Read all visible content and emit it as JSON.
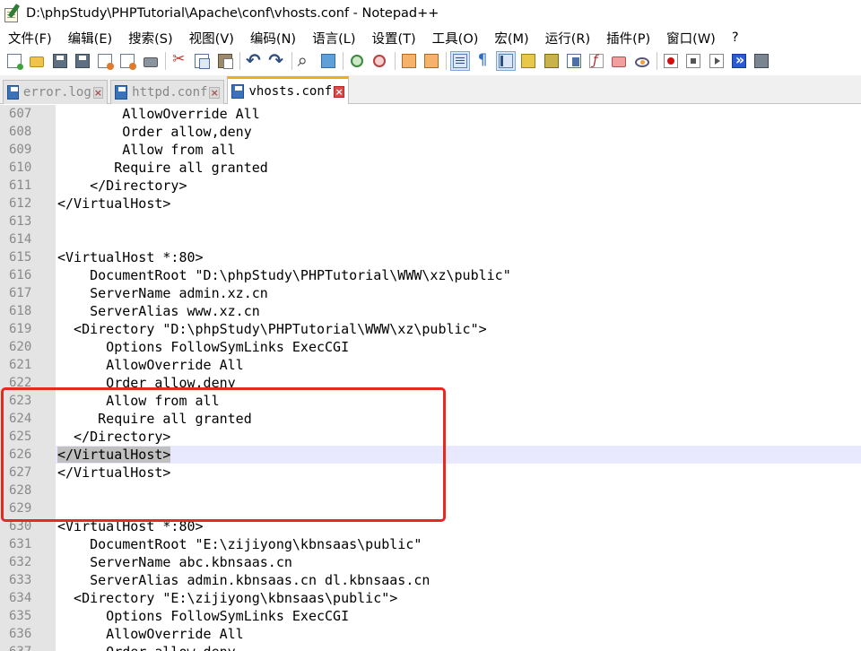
{
  "window": {
    "title": "D:\\phpStudy\\PHPTutorial\\Apache\\conf\\vhosts.conf - Notepad++"
  },
  "menu": {
    "items": [
      "文件(F)",
      "编辑(E)",
      "搜索(S)",
      "视图(V)",
      "编码(N)",
      "语言(L)",
      "设置(T)",
      "工具(O)",
      "宏(M)",
      "运行(R)",
      "插件(P)",
      "窗口(W)",
      "?"
    ]
  },
  "toolbar": {
    "icons": [
      "new-file-icon",
      "open-file-icon",
      "save-icon",
      "save-all-icon",
      "close-icon",
      "close-all-icon",
      "print-icon",
      "cut-icon",
      "copy-icon",
      "paste-icon",
      "undo-icon",
      "redo-icon",
      "find-icon",
      "replace-icon",
      "zoom-in-icon",
      "zoom-out-icon",
      "sync-vertical-icon",
      "sync-horizontal-icon",
      "word-wrap-icon",
      "show-all-characters-icon",
      "indent-guide-icon",
      "user-language-icon",
      "document-map-icon",
      "document-list-icon",
      "function-list-icon",
      "folder-as-workspace-icon",
      "monitoring-icon",
      "record-macro-icon",
      "stop-recording-icon",
      "playback-macro-icon",
      "run-macro-multiple-icon",
      "save-macro-icon"
    ]
  },
  "tabs": [
    {
      "label": "error.log",
      "active": false
    },
    {
      "label": "httpd.conf",
      "active": false
    },
    {
      "label": "vhosts.conf",
      "active": true
    }
  ],
  "editor": {
    "lines": [
      {
        "num": "607",
        "text": "        AllowOverride All"
      },
      {
        "num": "608",
        "text": "        Order allow,deny"
      },
      {
        "num": "609",
        "text": "        Allow from all"
      },
      {
        "num": "610",
        "text": "       Require all granted"
      },
      {
        "num": "611",
        "text": "    </Directory>"
      },
      {
        "num": "612",
        "text": "</VirtualHost>"
      },
      {
        "num": "613",
        "text": ""
      },
      {
        "num": "614",
        "text": ""
      },
      {
        "num": "615",
        "text": "<VirtualHost *:80>"
      },
      {
        "num": "616",
        "text": "    DocumentRoot \"D:\\phpStudy\\PHPTutorial\\WWW\\xz\\public\""
      },
      {
        "num": "617",
        "text": "    ServerName admin.xz.cn"
      },
      {
        "num": "618",
        "text": "    ServerAlias www.xz.cn"
      },
      {
        "num": "619",
        "text": "  <Directory \"D:\\phpStudy\\PHPTutorial\\WWW\\xz\\public\">"
      },
      {
        "num": "620",
        "text": "      Options FollowSymLinks ExecCGI"
      },
      {
        "num": "621",
        "text": "      AllowOverride All"
      },
      {
        "num": "622",
        "text": "      Order allow,deny"
      },
      {
        "num": "623",
        "text": "      Allow from all"
      },
      {
        "num": "624",
        "text": "     Require all granted"
      },
      {
        "num": "625",
        "text": "  </Directory>"
      },
      {
        "num": "626",
        "text": "</VirtualHost>",
        "current": true
      },
      {
        "num": "627",
        "text": "</VirtualHost>"
      },
      {
        "num": "628",
        "text": ""
      },
      {
        "num": "629",
        "text": ""
      },
      {
        "num": "630",
        "text": "<VirtualHost *:80>"
      },
      {
        "num": "631",
        "text": "    DocumentRoot \"E:\\zijiyong\\kbnsaas\\public\""
      },
      {
        "num": "632",
        "text": "    ServerName abc.kbnsaas.cn"
      },
      {
        "num": "633",
        "text": "    ServerAlias admin.kbnsaas.cn dl.kbnsaas.cn"
      },
      {
        "num": "634",
        "text": "  <Directory \"E:\\zijiyong\\kbnsaas\\public\">"
      },
      {
        "num": "635",
        "text": "      Options FollowSymLinks ExecCGI"
      },
      {
        "num": "636",
        "text": "      AllowOverride All"
      },
      {
        "num": "637",
        "text": "      Order allow,deny"
      }
    ]
  },
  "colors": {
    "highlight_box": "#e8291d",
    "active_tab_accent": "#f5a623",
    "current_line": "#e8e8ff"
  }
}
